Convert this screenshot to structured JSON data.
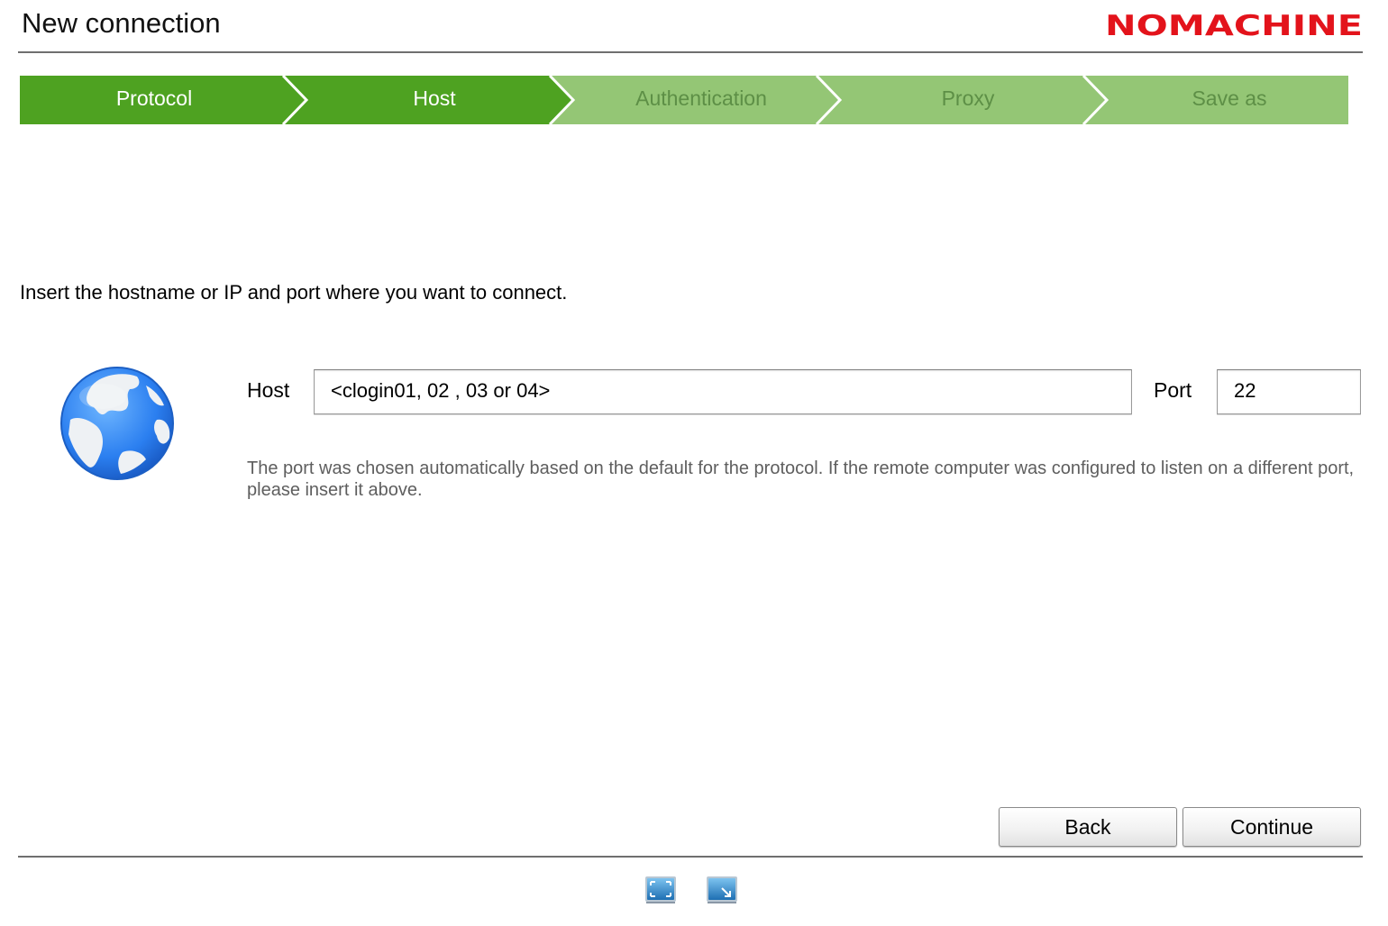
{
  "window": {
    "title": "New connection",
    "brand": "NOMACHINE",
    "brand_color": "#e3131b"
  },
  "steps": [
    {
      "label": "Protocol",
      "state": "done"
    },
    {
      "label": "Host",
      "state": "current"
    },
    {
      "label": "Authentication",
      "state": "pending"
    },
    {
      "label": "Proxy",
      "state": "pending"
    },
    {
      "label": "Save as",
      "state": "pending"
    }
  ],
  "colors": {
    "step_active": "#4ea221",
    "step_inactive": "#94c675"
  },
  "main": {
    "instruction": "Insert the hostname or IP and port where you want to connect.",
    "icon": "globe-icon",
    "host_label": "Host",
    "host_value": "<clogin01, 02 , 03 or 04>",
    "port_label": "Port",
    "port_value": "22",
    "help": "The port was chosen automatically based on the default for the protocol. If the remote computer was configured to listen on a different port, please insert it above."
  },
  "buttons": {
    "back": "Back",
    "continue": "Continue"
  },
  "footer": {
    "icons": [
      "fullscreen-icon",
      "resize-window-icon"
    ]
  }
}
